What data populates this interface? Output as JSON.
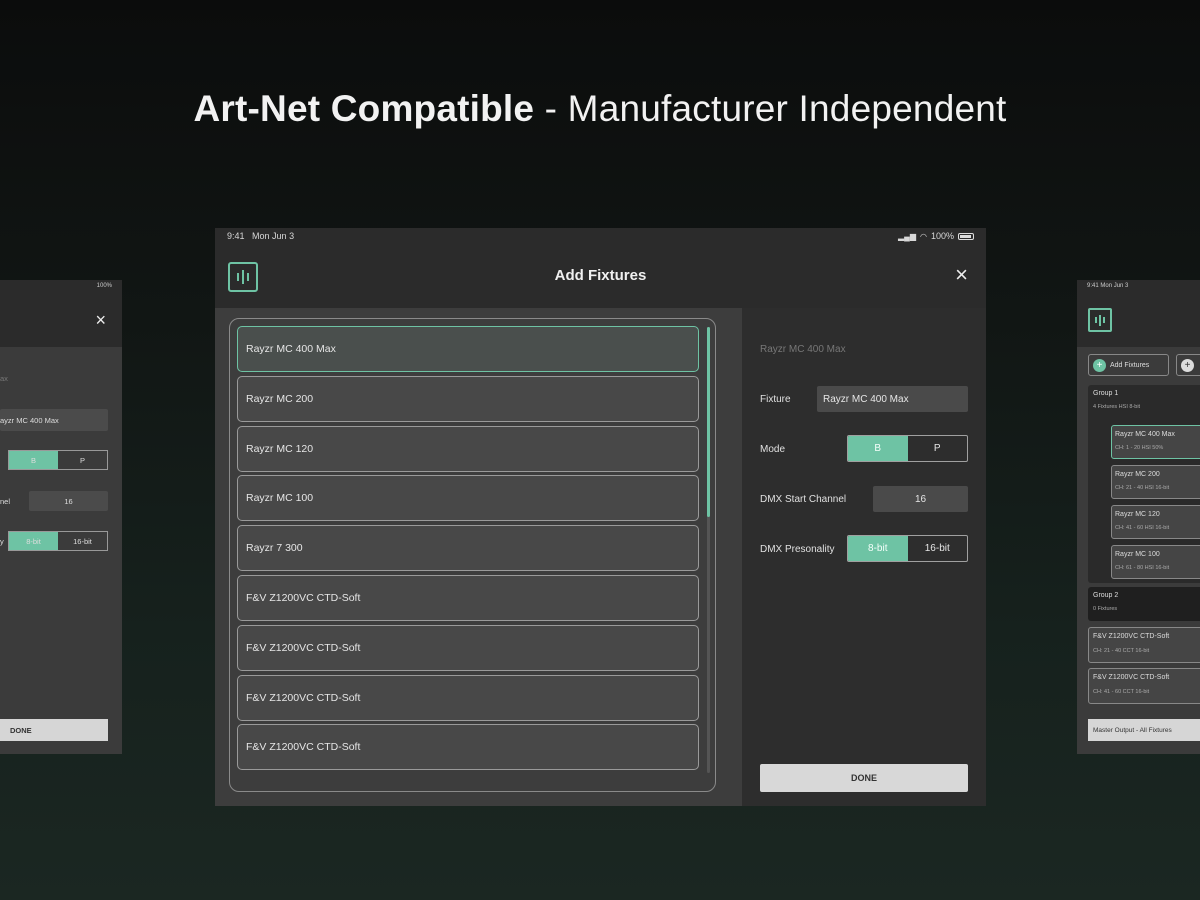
{
  "headline": {
    "bold": "Art-Net Compatible",
    "light": " - Manufacturer Independent"
  },
  "main": {
    "status": {
      "time": "9:41",
      "date": "Mon Jun 3",
      "battery": "100%"
    },
    "title": "Add Fixtures",
    "close_icon": "×",
    "fixtures": [
      "Rayzr MC 400 Max",
      "Rayzr MC 200",
      "Rayzr MC 120",
      "Rayzr MC 100",
      "Rayzr 7 300",
      "F&V Z1200VC CTD-Soft",
      "F&V Z1200VC CTD-Soft",
      "F&V Z1200VC CTD-Soft",
      "F&V Z1200VC CTD-Soft"
    ],
    "selected_name": "Rayzr MC 400 Max",
    "fixture_label": "Fixture",
    "fixture_value": "Rayzr MC 400 Max",
    "mode_label": "Mode",
    "mode_options": [
      "B",
      "P"
    ],
    "dmx_start_label": "DMX Start Channel",
    "dmx_start_value": "16",
    "personality_label": "DMX Presonality",
    "personality_options": [
      "8-bit",
      "16-bit"
    ],
    "done": "DONE"
  },
  "left_side": {
    "status": "100%",
    "close_icon": "×",
    "sel_name": "ax",
    "fixture_value": "ayzr MC 400 Max",
    "mode_options": [
      "B",
      "P"
    ],
    "channel_label": "nel",
    "channel_value": "16",
    "pers_label": "y",
    "pers_options": [
      "8-bit",
      "16-bit"
    ],
    "done": "DONE"
  },
  "right_side": {
    "status": {
      "time": "9:41",
      "date": "Mon Jun 3"
    },
    "add_fixtures": "Add Fixtures",
    "group1": {
      "title": "Group 1",
      "sub": "4 Fixtures      HSI       8-bit"
    },
    "group1_items": [
      {
        "title": "Rayzr MC 400 Max",
        "sub": "CH: 1 - 20        HSI       50%"
      },
      {
        "title": "Rayzr MC 200",
        "sub": "CH: 21 - 40       HSI       16-bit"
      },
      {
        "title": "Rayzr MC 120",
        "sub": "CH: 41 - 60       HSI       16-bit"
      },
      {
        "title": "Rayzr MC 100",
        "sub": "CH: 61 - 80       HSI       16-bit"
      }
    ],
    "group2": {
      "title": "Group 2",
      "sub": "0 Fixtures"
    },
    "items": [
      {
        "title": "F&V Z1200VC CTD-Soft",
        "sub": "CH: 21 - 40       CCT       16-bit"
      },
      {
        "title": "F&V Z1200VC CTD-Soft",
        "sub": "CH: 41 - 60       CCT       16-bit"
      }
    ],
    "master": "Master Output - All Fixtures"
  }
}
